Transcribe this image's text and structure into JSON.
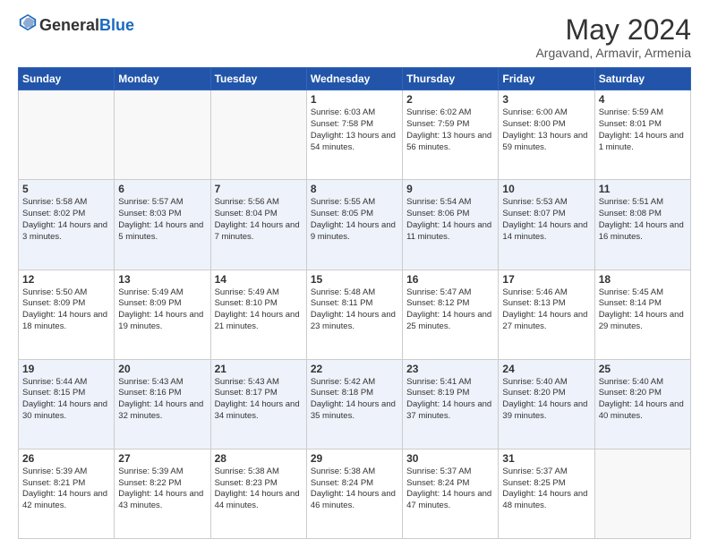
{
  "header": {
    "logo_general": "General",
    "logo_blue": "Blue",
    "month_title": "May 2024",
    "location": "Argavand, Armavir, Armenia"
  },
  "weekdays": [
    "Sunday",
    "Monday",
    "Tuesday",
    "Wednesday",
    "Thursday",
    "Friday",
    "Saturday"
  ],
  "rows": [
    [
      {
        "day": "",
        "sunrise": "",
        "sunset": "",
        "daylight": ""
      },
      {
        "day": "",
        "sunrise": "",
        "sunset": "",
        "daylight": ""
      },
      {
        "day": "",
        "sunrise": "",
        "sunset": "",
        "daylight": ""
      },
      {
        "day": "1",
        "sunrise": "Sunrise: 6:03 AM",
        "sunset": "Sunset: 7:58 PM",
        "daylight": "Daylight: 13 hours and 54 minutes."
      },
      {
        "day": "2",
        "sunrise": "Sunrise: 6:02 AM",
        "sunset": "Sunset: 7:59 PM",
        "daylight": "Daylight: 13 hours and 56 minutes."
      },
      {
        "day": "3",
        "sunrise": "Sunrise: 6:00 AM",
        "sunset": "Sunset: 8:00 PM",
        "daylight": "Daylight: 13 hours and 59 minutes."
      },
      {
        "day": "4",
        "sunrise": "Sunrise: 5:59 AM",
        "sunset": "Sunset: 8:01 PM",
        "daylight": "Daylight: 14 hours and 1 minute."
      }
    ],
    [
      {
        "day": "5",
        "sunrise": "Sunrise: 5:58 AM",
        "sunset": "Sunset: 8:02 PM",
        "daylight": "Daylight: 14 hours and 3 minutes."
      },
      {
        "day": "6",
        "sunrise": "Sunrise: 5:57 AM",
        "sunset": "Sunset: 8:03 PM",
        "daylight": "Daylight: 14 hours and 5 minutes."
      },
      {
        "day": "7",
        "sunrise": "Sunrise: 5:56 AM",
        "sunset": "Sunset: 8:04 PM",
        "daylight": "Daylight: 14 hours and 7 minutes."
      },
      {
        "day": "8",
        "sunrise": "Sunrise: 5:55 AM",
        "sunset": "Sunset: 8:05 PM",
        "daylight": "Daylight: 14 hours and 9 minutes."
      },
      {
        "day": "9",
        "sunrise": "Sunrise: 5:54 AM",
        "sunset": "Sunset: 8:06 PM",
        "daylight": "Daylight: 14 hours and 11 minutes."
      },
      {
        "day": "10",
        "sunrise": "Sunrise: 5:53 AM",
        "sunset": "Sunset: 8:07 PM",
        "daylight": "Daylight: 14 hours and 14 minutes."
      },
      {
        "day": "11",
        "sunrise": "Sunrise: 5:51 AM",
        "sunset": "Sunset: 8:08 PM",
        "daylight": "Daylight: 14 hours and 16 minutes."
      }
    ],
    [
      {
        "day": "12",
        "sunrise": "Sunrise: 5:50 AM",
        "sunset": "Sunset: 8:09 PM",
        "daylight": "Daylight: 14 hours and 18 minutes."
      },
      {
        "day": "13",
        "sunrise": "Sunrise: 5:49 AM",
        "sunset": "Sunset: 8:09 PM",
        "daylight": "Daylight: 14 hours and 19 minutes."
      },
      {
        "day": "14",
        "sunrise": "Sunrise: 5:49 AM",
        "sunset": "Sunset: 8:10 PM",
        "daylight": "Daylight: 14 hours and 21 minutes."
      },
      {
        "day": "15",
        "sunrise": "Sunrise: 5:48 AM",
        "sunset": "Sunset: 8:11 PM",
        "daylight": "Daylight: 14 hours and 23 minutes."
      },
      {
        "day": "16",
        "sunrise": "Sunrise: 5:47 AM",
        "sunset": "Sunset: 8:12 PM",
        "daylight": "Daylight: 14 hours and 25 minutes."
      },
      {
        "day": "17",
        "sunrise": "Sunrise: 5:46 AM",
        "sunset": "Sunset: 8:13 PM",
        "daylight": "Daylight: 14 hours and 27 minutes."
      },
      {
        "day": "18",
        "sunrise": "Sunrise: 5:45 AM",
        "sunset": "Sunset: 8:14 PM",
        "daylight": "Daylight: 14 hours and 29 minutes."
      }
    ],
    [
      {
        "day": "19",
        "sunrise": "Sunrise: 5:44 AM",
        "sunset": "Sunset: 8:15 PM",
        "daylight": "Daylight: 14 hours and 30 minutes."
      },
      {
        "day": "20",
        "sunrise": "Sunrise: 5:43 AM",
        "sunset": "Sunset: 8:16 PM",
        "daylight": "Daylight: 14 hours and 32 minutes."
      },
      {
        "day": "21",
        "sunrise": "Sunrise: 5:43 AM",
        "sunset": "Sunset: 8:17 PM",
        "daylight": "Daylight: 14 hours and 34 minutes."
      },
      {
        "day": "22",
        "sunrise": "Sunrise: 5:42 AM",
        "sunset": "Sunset: 8:18 PM",
        "daylight": "Daylight: 14 hours and 35 minutes."
      },
      {
        "day": "23",
        "sunrise": "Sunrise: 5:41 AM",
        "sunset": "Sunset: 8:19 PM",
        "daylight": "Daylight: 14 hours and 37 minutes."
      },
      {
        "day": "24",
        "sunrise": "Sunrise: 5:40 AM",
        "sunset": "Sunset: 8:20 PM",
        "daylight": "Daylight: 14 hours and 39 minutes."
      },
      {
        "day": "25",
        "sunrise": "Sunrise: 5:40 AM",
        "sunset": "Sunset: 8:20 PM",
        "daylight": "Daylight: 14 hours and 40 minutes."
      }
    ],
    [
      {
        "day": "26",
        "sunrise": "Sunrise: 5:39 AM",
        "sunset": "Sunset: 8:21 PM",
        "daylight": "Daylight: 14 hours and 42 minutes."
      },
      {
        "day": "27",
        "sunrise": "Sunrise: 5:39 AM",
        "sunset": "Sunset: 8:22 PM",
        "daylight": "Daylight: 14 hours and 43 minutes."
      },
      {
        "day": "28",
        "sunrise": "Sunrise: 5:38 AM",
        "sunset": "Sunset: 8:23 PM",
        "daylight": "Daylight: 14 hours and 44 minutes."
      },
      {
        "day": "29",
        "sunrise": "Sunrise: 5:38 AM",
        "sunset": "Sunset: 8:24 PM",
        "daylight": "Daylight: 14 hours and 46 minutes."
      },
      {
        "day": "30",
        "sunrise": "Sunrise: 5:37 AM",
        "sunset": "Sunset: 8:24 PM",
        "daylight": "Daylight: 14 hours and 47 minutes."
      },
      {
        "day": "31",
        "sunrise": "Sunrise: 5:37 AM",
        "sunset": "Sunset: 8:25 PM",
        "daylight": "Daylight: 14 hours and 48 minutes."
      },
      {
        "day": "",
        "sunrise": "",
        "sunset": "",
        "daylight": ""
      }
    ]
  ]
}
